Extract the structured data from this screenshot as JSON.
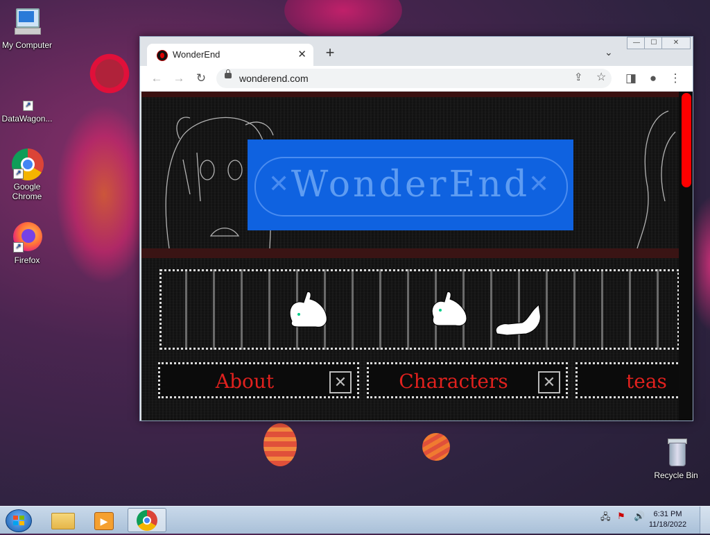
{
  "desktop": {
    "icons": [
      {
        "label": "My Computer"
      },
      {
        "label": "DataWagon..."
      },
      {
        "label": "Google Chrome"
      },
      {
        "label": "Firefox"
      },
      {
        "label": "Recycle Bin"
      }
    ]
  },
  "browser": {
    "tab": {
      "title": "WonderEnd",
      "close": "✕"
    },
    "new_tab": "+",
    "tab_menu": "⌄",
    "window_controls": {
      "minimize": "—",
      "maximize": "☐",
      "close": "✕"
    },
    "address": {
      "url": "wonderend.com"
    }
  },
  "page": {
    "logo_text": "WonderEnd",
    "nav": [
      {
        "label": "About"
      },
      {
        "label": "Characters"
      },
      {
        "label": "teas"
      }
    ],
    "scroll_thumb_color": "#ff0000",
    "logo_color": "#0f62e0",
    "nav_label_color": "#e0211e"
  },
  "taskbar": {
    "clock_time": "6:31 PM",
    "clock_date": "11/18/2022"
  }
}
